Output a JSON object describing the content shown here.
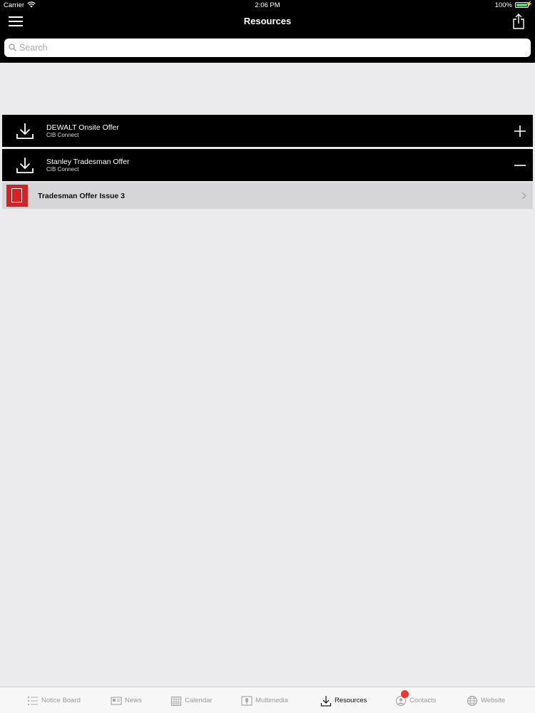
{
  "status": {
    "carrier": "Carrier",
    "time": "2:06 PM",
    "battery": "100%"
  },
  "nav": {
    "title": "Resources"
  },
  "search": {
    "placeholder": "Search"
  },
  "resources": [
    {
      "title": "DEWALT Onsite Offer",
      "subtitle": "CIB Connect",
      "expanded": false
    },
    {
      "title": "Stanley Tradesman Offer",
      "subtitle": "CIB Connect",
      "expanded": true
    }
  ],
  "document": {
    "title": "Tradesman Offer Issue 3",
    "icon": "pdf-icon"
  },
  "tabs": [
    {
      "label": "Notice Board",
      "icon": "list-icon"
    },
    {
      "label": "News",
      "icon": "newspaper-icon"
    },
    {
      "label": "Calendar",
      "icon": "calendar-icon"
    },
    {
      "label": "Multimedia",
      "icon": "multimedia-icon"
    },
    {
      "label": "Resources",
      "icon": "download-icon",
      "active": true
    },
    {
      "label": "Contacts",
      "icon": "contacts-icon"
    },
    {
      "label": "Website",
      "icon": "globe-icon"
    }
  ],
  "colors": {
    "accent": "#d82027",
    "battery": "#4cd964",
    "badge": "#e8382f"
  }
}
